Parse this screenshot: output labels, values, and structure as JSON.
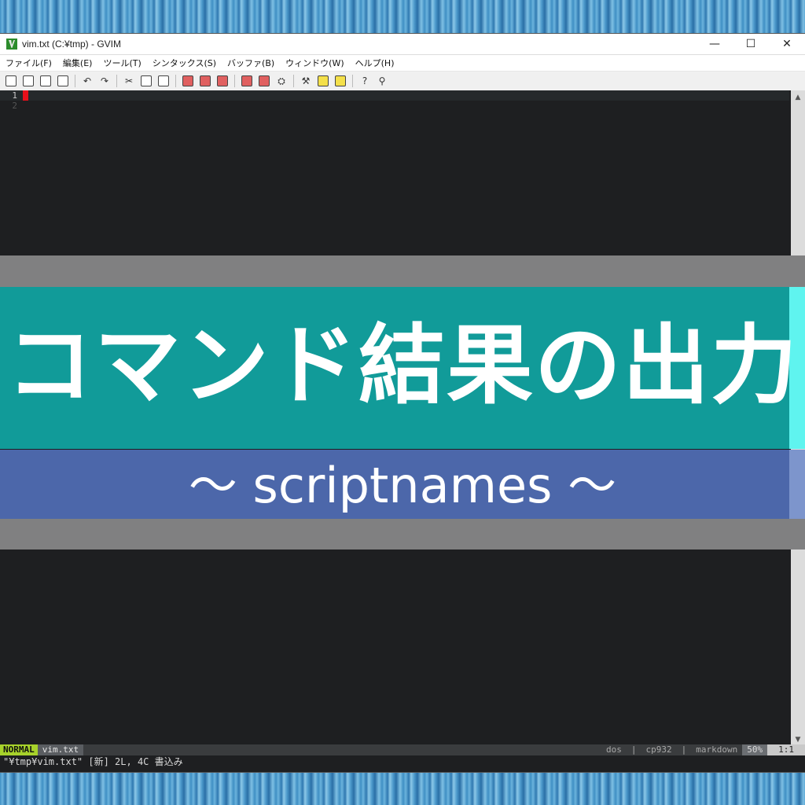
{
  "window": {
    "title": "vim.txt (C:¥tmp) - GVIM",
    "minimize": "—",
    "maximize": "☐",
    "close": "✕"
  },
  "menu": [
    "ファイル(F)",
    "編集(E)",
    "ツール(T)",
    "シンタックス(S)",
    "バッファ(B)",
    "ウィンドウ(W)",
    "ヘルプ(H)"
  ],
  "editor": {
    "line_numbers": [
      "1",
      "2"
    ]
  },
  "overlay": {
    "headline": "コマンド結果の出力",
    "subline": "～ scriptnames ～"
  },
  "status": {
    "mode": "NORMAL",
    "file": "vim.txt",
    "format": "dos",
    "encoding": "cp932",
    "filetype": "markdown",
    "percent": "50%",
    "position": "1:1"
  },
  "cmdline": "\"¥tmp¥vim.txt\" [新] 2L, 4C 書込み",
  "colors": {
    "teal": "#119b99",
    "blue": "#4c67aa",
    "mode": "#a7d22b",
    "cursor": "#e8101a"
  }
}
